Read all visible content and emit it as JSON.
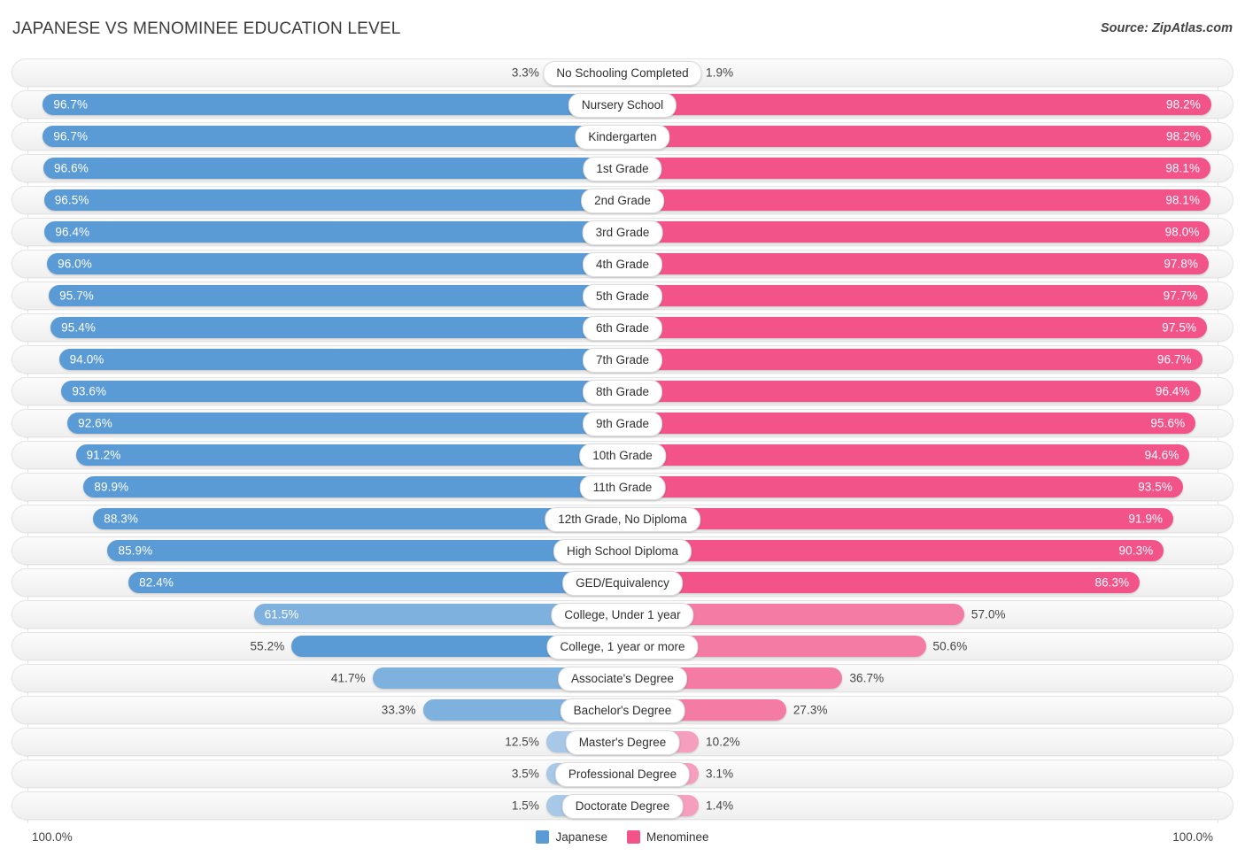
{
  "header": {
    "title": "JAPANESE VS MENOMINEE EDUCATION LEVEL",
    "source": "Source: ZipAtlas.com"
  },
  "footer": {
    "axis_left": "100.0%",
    "axis_right": "100.0%",
    "legend": [
      {
        "label": "Japanese",
        "color": "#5B9BD5"
      },
      {
        "label": "Menominee",
        "color": "#F2548A"
      }
    ]
  },
  "colors": {
    "japanese_strong": "#5B9BD5",
    "japanese_light": "#A8C8E8",
    "menominee_strong": "#F2548A",
    "menominee_medium": "#F47CA4",
    "menominee_light": "#F59EBD",
    "track": "#F5F5F5",
    "gridline": "#E6E6E6"
  },
  "chart_data": {
    "type": "bar",
    "orientation": "diverging-horizontal",
    "title": "JAPANESE VS MENOMINEE EDUCATION LEVEL",
    "xlabel": "",
    "ylabel": "",
    "axis_max": 100.0,
    "axis_unit": "%",
    "grid": true,
    "legend_position": "bottom-center",
    "categories": [
      "No Schooling Completed",
      "Nursery School",
      "Kindergarten",
      "1st Grade",
      "2nd Grade",
      "3rd Grade",
      "4th Grade",
      "5th Grade",
      "6th Grade",
      "7th Grade",
      "8th Grade",
      "9th Grade",
      "10th Grade",
      "11th Grade",
      "12th Grade, No Diploma",
      "High School Diploma",
      "GED/Equivalency",
      "College, Under 1 year",
      "College, 1 year or more",
      "Associate's Degree",
      "Bachelor's Degree",
      "Master's Degree",
      "Professional Degree",
      "Doctorate Degree"
    ],
    "series": [
      {
        "name": "Japanese",
        "color": "#5B9BD5",
        "values": [
          3.3,
          96.7,
          96.7,
          96.6,
          96.5,
          96.4,
          96.0,
          95.7,
          95.4,
          94.0,
          93.6,
          92.6,
          91.2,
          89.9,
          88.3,
          85.9,
          82.4,
          61.5,
          55.2,
          41.7,
          33.3,
          12.5,
          3.5,
          1.5
        ]
      },
      {
        "name": "Menominee",
        "color": "#F2548A",
        "values": [
          1.9,
          98.2,
          98.2,
          98.1,
          98.1,
          98.0,
          97.8,
          97.7,
          97.5,
          96.7,
          96.4,
          95.6,
          94.6,
          93.5,
          91.9,
          90.3,
          86.3,
          57.0,
          50.6,
          36.7,
          27.3,
          10.2,
          3.1,
          1.4
        ]
      }
    ],
    "rows": [
      {
        "label": "No Schooling Completed",
        "left_value": 3.3,
        "left_text": "3.3%",
        "right_value": 1.9,
        "right_text": "1.9%",
        "left_inside": false,
        "right_inside": false,
        "left_tone": "light",
        "right_tone": "light"
      },
      {
        "label": "Nursery School",
        "left_value": 96.7,
        "left_text": "96.7%",
        "right_value": 98.2,
        "right_text": "98.2%",
        "left_inside": true,
        "right_inside": true,
        "left_tone": "strong",
        "right_tone": "strong"
      },
      {
        "label": "Kindergarten",
        "left_value": 96.7,
        "left_text": "96.7%",
        "right_value": 98.2,
        "right_text": "98.2%",
        "left_inside": true,
        "right_inside": true,
        "left_tone": "strong",
        "right_tone": "strong"
      },
      {
        "label": "1st Grade",
        "left_value": 96.6,
        "left_text": "96.6%",
        "right_value": 98.1,
        "right_text": "98.1%",
        "left_inside": true,
        "right_inside": true,
        "left_tone": "strong",
        "right_tone": "strong"
      },
      {
        "label": "2nd Grade",
        "left_value": 96.5,
        "left_text": "96.5%",
        "right_value": 98.1,
        "right_text": "98.1%",
        "left_inside": true,
        "right_inside": true,
        "left_tone": "strong",
        "right_tone": "strong"
      },
      {
        "label": "3rd Grade",
        "left_value": 96.4,
        "left_text": "96.4%",
        "right_value": 98.0,
        "right_text": "98.0%",
        "left_inside": true,
        "right_inside": true,
        "left_tone": "strong",
        "right_tone": "strong"
      },
      {
        "label": "4th Grade",
        "left_value": 96.0,
        "left_text": "96.0%",
        "right_value": 97.8,
        "right_text": "97.8%",
        "left_inside": true,
        "right_inside": true,
        "left_tone": "strong",
        "right_tone": "strong"
      },
      {
        "label": "5th Grade",
        "left_value": 95.7,
        "left_text": "95.7%",
        "right_value": 97.7,
        "right_text": "97.7%",
        "left_inside": true,
        "right_inside": true,
        "left_tone": "strong",
        "right_tone": "strong"
      },
      {
        "label": "6th Grade",
        "left_value": 95.4,
        "left_text": "95.4%",
        "right_value": 97.5,
        "right_text": "97.5%",
        "left_inside": true,
        "right_inside": true,
        "left_tone": "strong",
        "right_tone": "strong"
      },
      {
        "label": "7th Grade",
        "left_value": 94.0,
        "left_text": "94.0%",
        "right_value": 96.7,
        "right_text": "96.7%",
        "left_inside": true,
        "right_inside": true,
        "left_tone": "strong",
        "right_tone": "strong"
      },
      {
        "label": "8th Grade",
        "left_value": 93.6,
        "left_text": "93.6%",
        "right_value": 96.4,
        "right_text": "96.4%",
        "left_inside": true,
        "right_inside": true,
        "left_tone": "strong",
        "right_tone": "strong"
      },
      {
        "label": "9th Grade",
        "left_value": 92.6,
        "left_text": "92.6%",
        "right_value": 95.6,
        "right_text": "95.6%",
        "left_inside": true,
        "right_inside": true,
        "left_tone": "strong",
        "right_tone": "strong"
      },
      {
        "label": "10th Grade",
        "left_value": 91.2,
        "left_text": "91.2%",
        "right_value": 94.6,
        "right_text": "94.6%",
        "left_inside": true,
        "right_inside": true,
        "left_tone": "strong",
        "right_tone": "strong"
      },
      {
        "label": "11th Grade",
        "left_value": 89.9,
        "left_text": "89.9%",
        "right_value": 93.5,
        "right_text": "93.5%",
        "left_inside": true,
        "right_inside": true,
        "left_tone": "strong",
        "right_tone": "strong"
      },
      {
        "label": "12th Grade, No Diploma",
        "left_value": 88.3,
        "left_text": "88.3%",
        "right_value": 91.9,
        "right_text": "91.9%",
        "left_inside": true,
        "right_inside": true,
        "left_tone": "strong",
        "right_tone": "strong"
      },
      {
        "label": "High School Diploma",
        "left_value": 85.9,
        "left_text": "85.9%",
        "right_value": 90.3,
        "right_text": "90.3%",
        "left_inside": true,
        "right_inside": true,
        "left_tone": "strong",
        "right_tone": "strong"
      },
      {
        "label": "GED/Equivalency",
        "left_value": 82.4,
        "left_text": "82.4%",
        "right_value": 86.3,
        "right_text": "86.3%",
        "left_inside": true,
        "right_inside": true,
        "left_tone": "strong",
        "right_tone": "strong"
      },
      {
        "label": "College, Under 1 year",
        "left_value": 61.5,
        "left_text": "61.5%",
        "right_value": 57.0,
        "right_text": "57.0%",
        "left_inside": true,
        "right_inside": false,
        "left_tone": "mid",
        "right_tone": "medium"
      },
      {
        "label": "College, 1 year or more",
        "left_value": 55.2,
        "left_text": "55.2%",
        "right_value": 50.6,
        "right_text": "50.6%",
        "left_inside": false,
        "right_inside": false,
        "left_tone": "strong",
        "right_tone": "medium"
      },
      {
        "label": "Associate's Degree",
        "left_value": 41.7,
        "left_text": "41.7%",
        "right_value": 36.7,
        "right_text": "36.7%",
        "left_inside": false,
        "right_inside": false,
        "left_tone": "mid",
        "right_tone": "medium"
      },
      {
        "label": "Bachelor's Degree",
        "left_value": 33.3,
        "left_text": "33.3%",
        "right_value": 27.3,
        "right_text": "27.3%",
        "left_inside": false,
        "right_inside": false,
        "left_tone": "mid",
        "right_tone": "medium"
      },
      {
        "label": "Master's Degree",
        "left_value": 12.5,
        "left_text": "12.5%",
        "right_value": 10.2,
        "right_text": "10.2%",
        "left_inside": false,
        "right_inside": false,
        "left_tone": "light",
        "right_tone": "light"
      },
      {
        "label": "Professional Degree",
        "left_value": 3.5,
        "left_text": "3.5%",
        "right_value": 3.1,
        "right_text": "3.1%",
        "left_inside": false,
        "right_inside": false,
        "left_tone": "light",
        "right_tone": "light"
      },
      {
        "label": "Doctorate Degree",
        "left_value": 1.5,
        "left_text": "1.5%",
        "right_value": 1.4,
        "right_text": "1.4%",
        "left_inside": false,
        "right_inside": false,
        "left_tone": "light",
        "right_tone": "light"
      }
    ]
  }
}
